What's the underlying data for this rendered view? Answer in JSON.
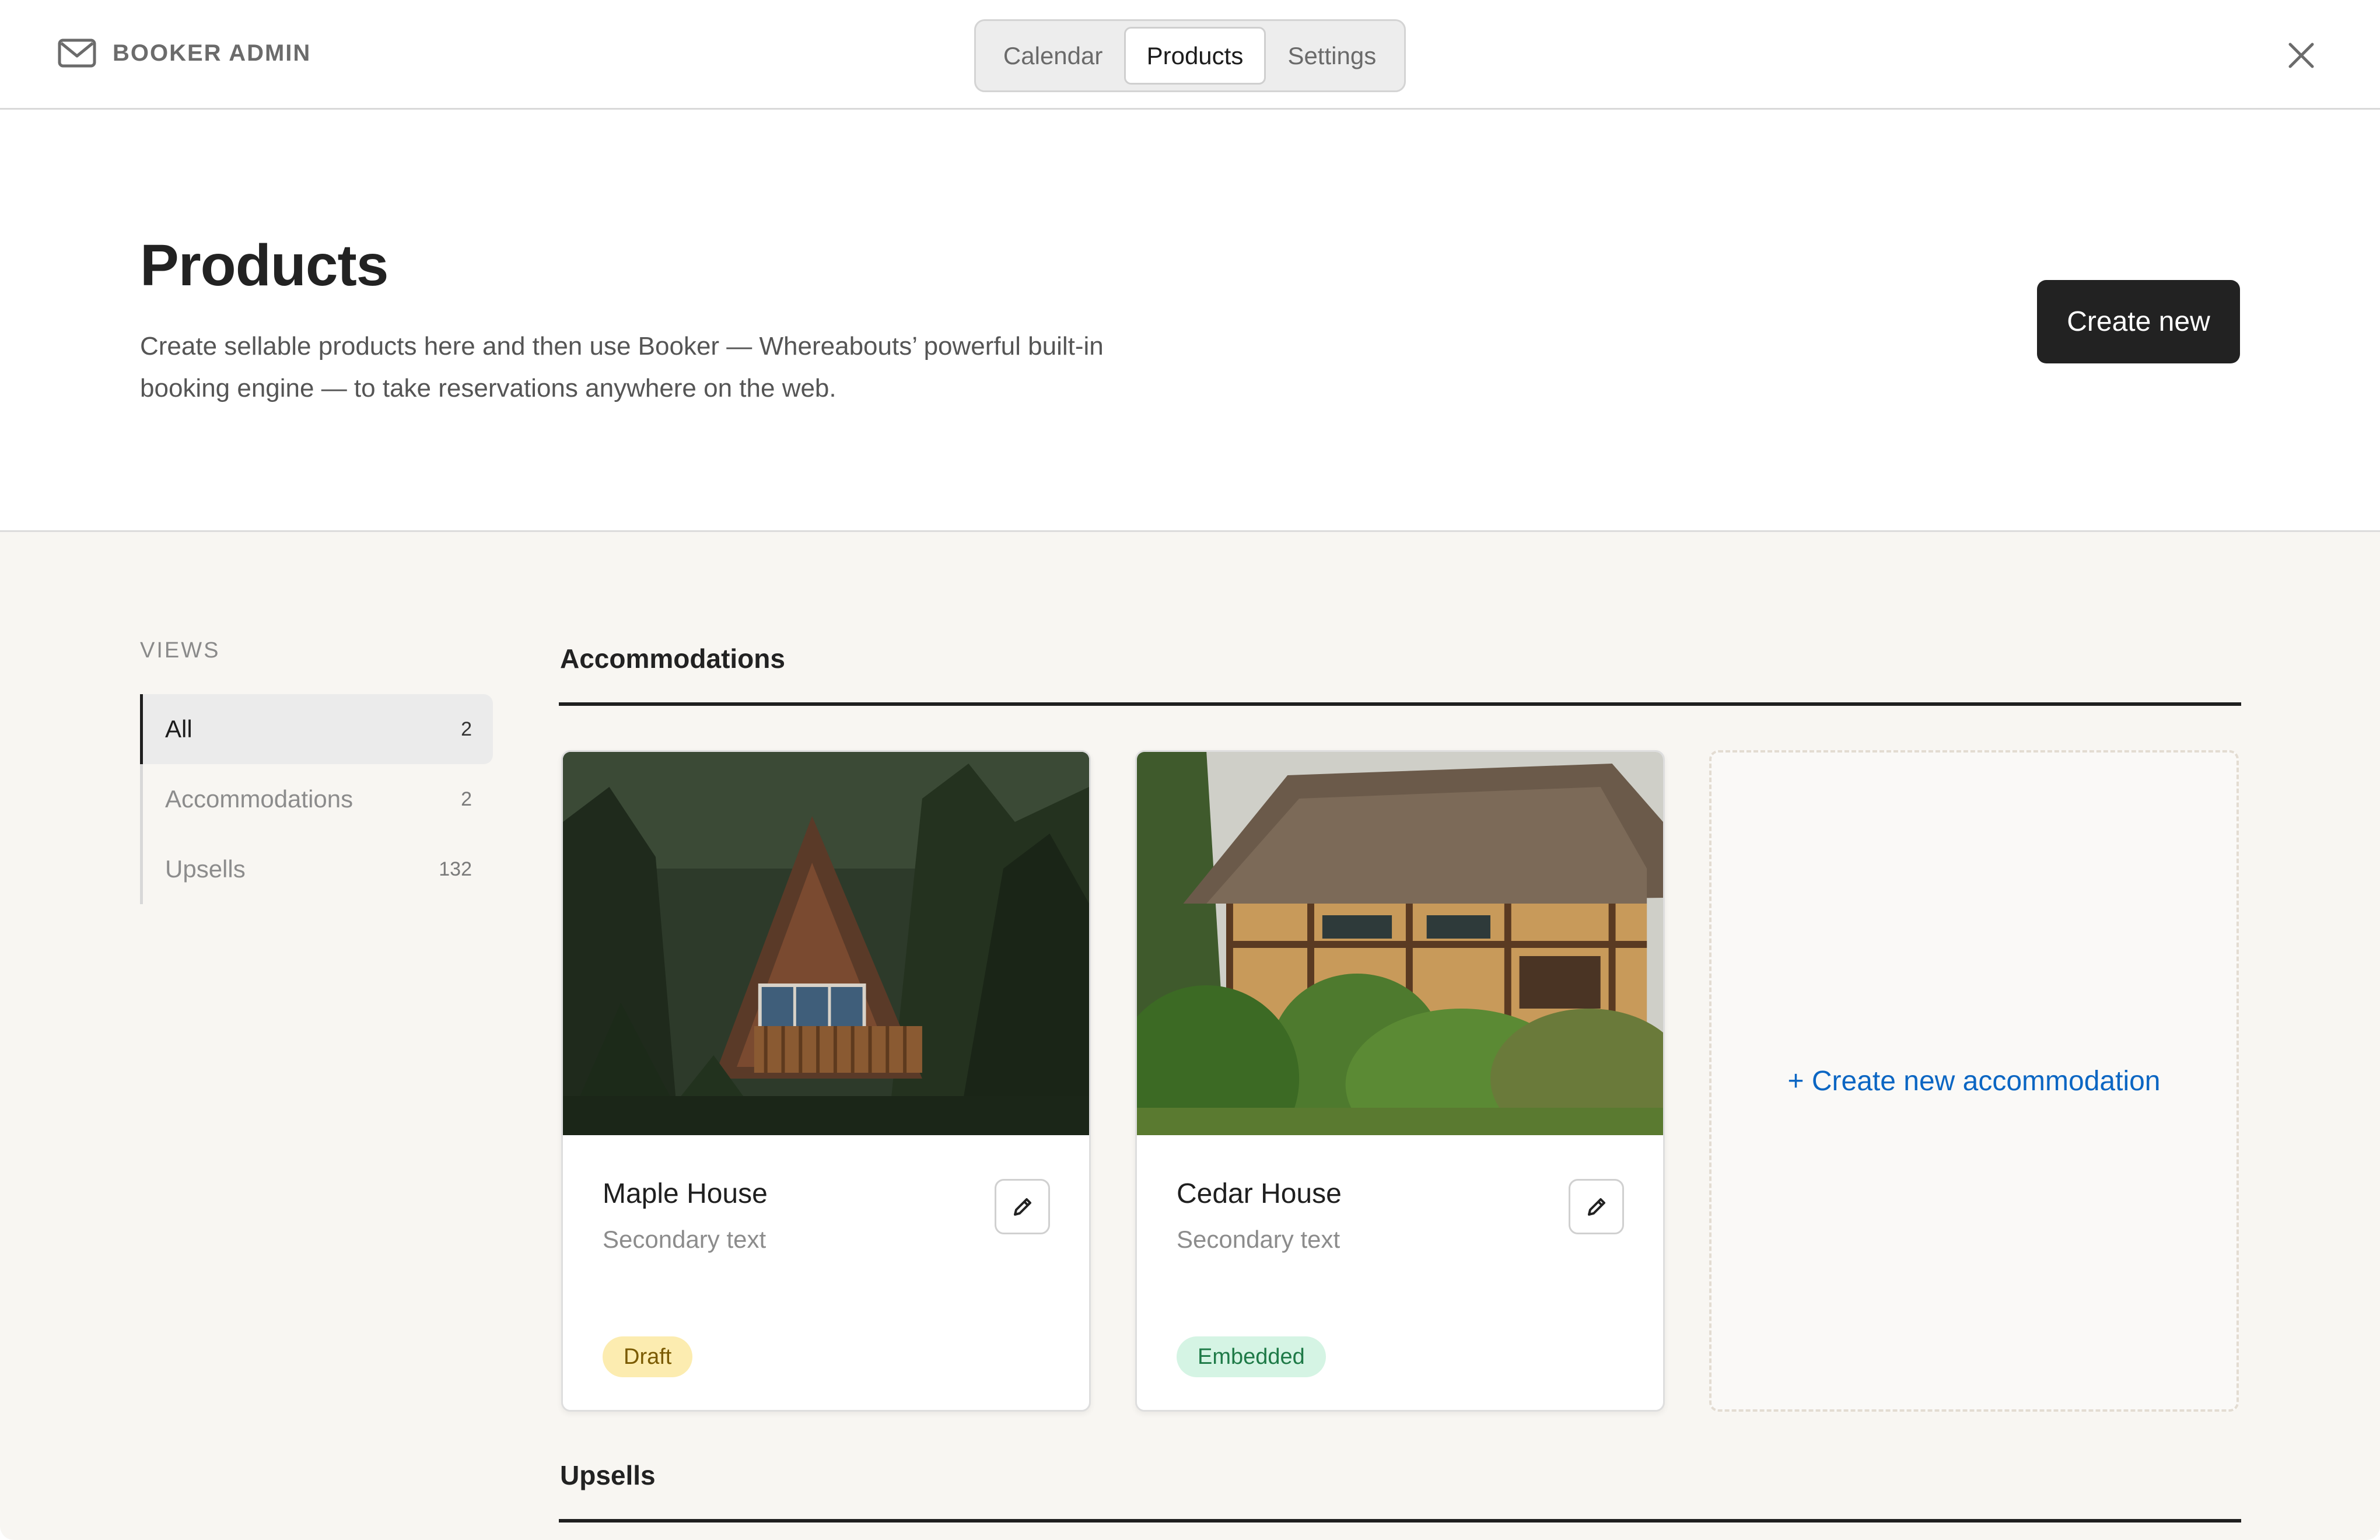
{
  "topbar": {
    "brand_name": "BOOKER ADMIN",
    "brand_icon": "mail-icon",
    "tabs": [
      {
        "label": "Calendar",
        "active": false
      },
      {
        "label": "Products",
        "active": true
      },
      {
        "label": "Settings",
        "active": false
      }
    ],
    "close_icon": "close-icon"
  },
  "header": {
    "title": "Products",
    "description": "Create sellable products here and then use Booker — Whereabouts’ powerful built-in booking engine — to take reservations anywhere on the web.",
    "create_button": "Create new"
  },
  "sidebar": {
    "heading": "VIEWS",
    "items": [
      {
        "label": "All",
        "count": "2",
        "active": true
      },
      {
        "label": "Accommodations",
        "count": "2",
        "active": false
      },
      {
        "label": "Upsells",
        "count": "132",
        "active": false
      }
    ]
  },
  "accommodations": {
    "title": "Accommodations",
    "cards": [
      {
        "name": "Maple House",
        "secondary": "Secondary text",
        "status": "Draft"
      },
      {
        "name": "Cedar House",
        "secondary": "Secondary text",
        "status": "Embedded"
      }
    ],
    "create_label": "+ Create new accommodation"
  },
  "upsells": {
    "title": "Upsells"
  },
  "colors": {
    "primary_button": "#222222",
    "link": "#0b66c3",
    "draft_badge": "#fcecb0",
    "embedded_badge": "#d5f4e4",
    "content_background": "#f8f6f2"
  }
}
